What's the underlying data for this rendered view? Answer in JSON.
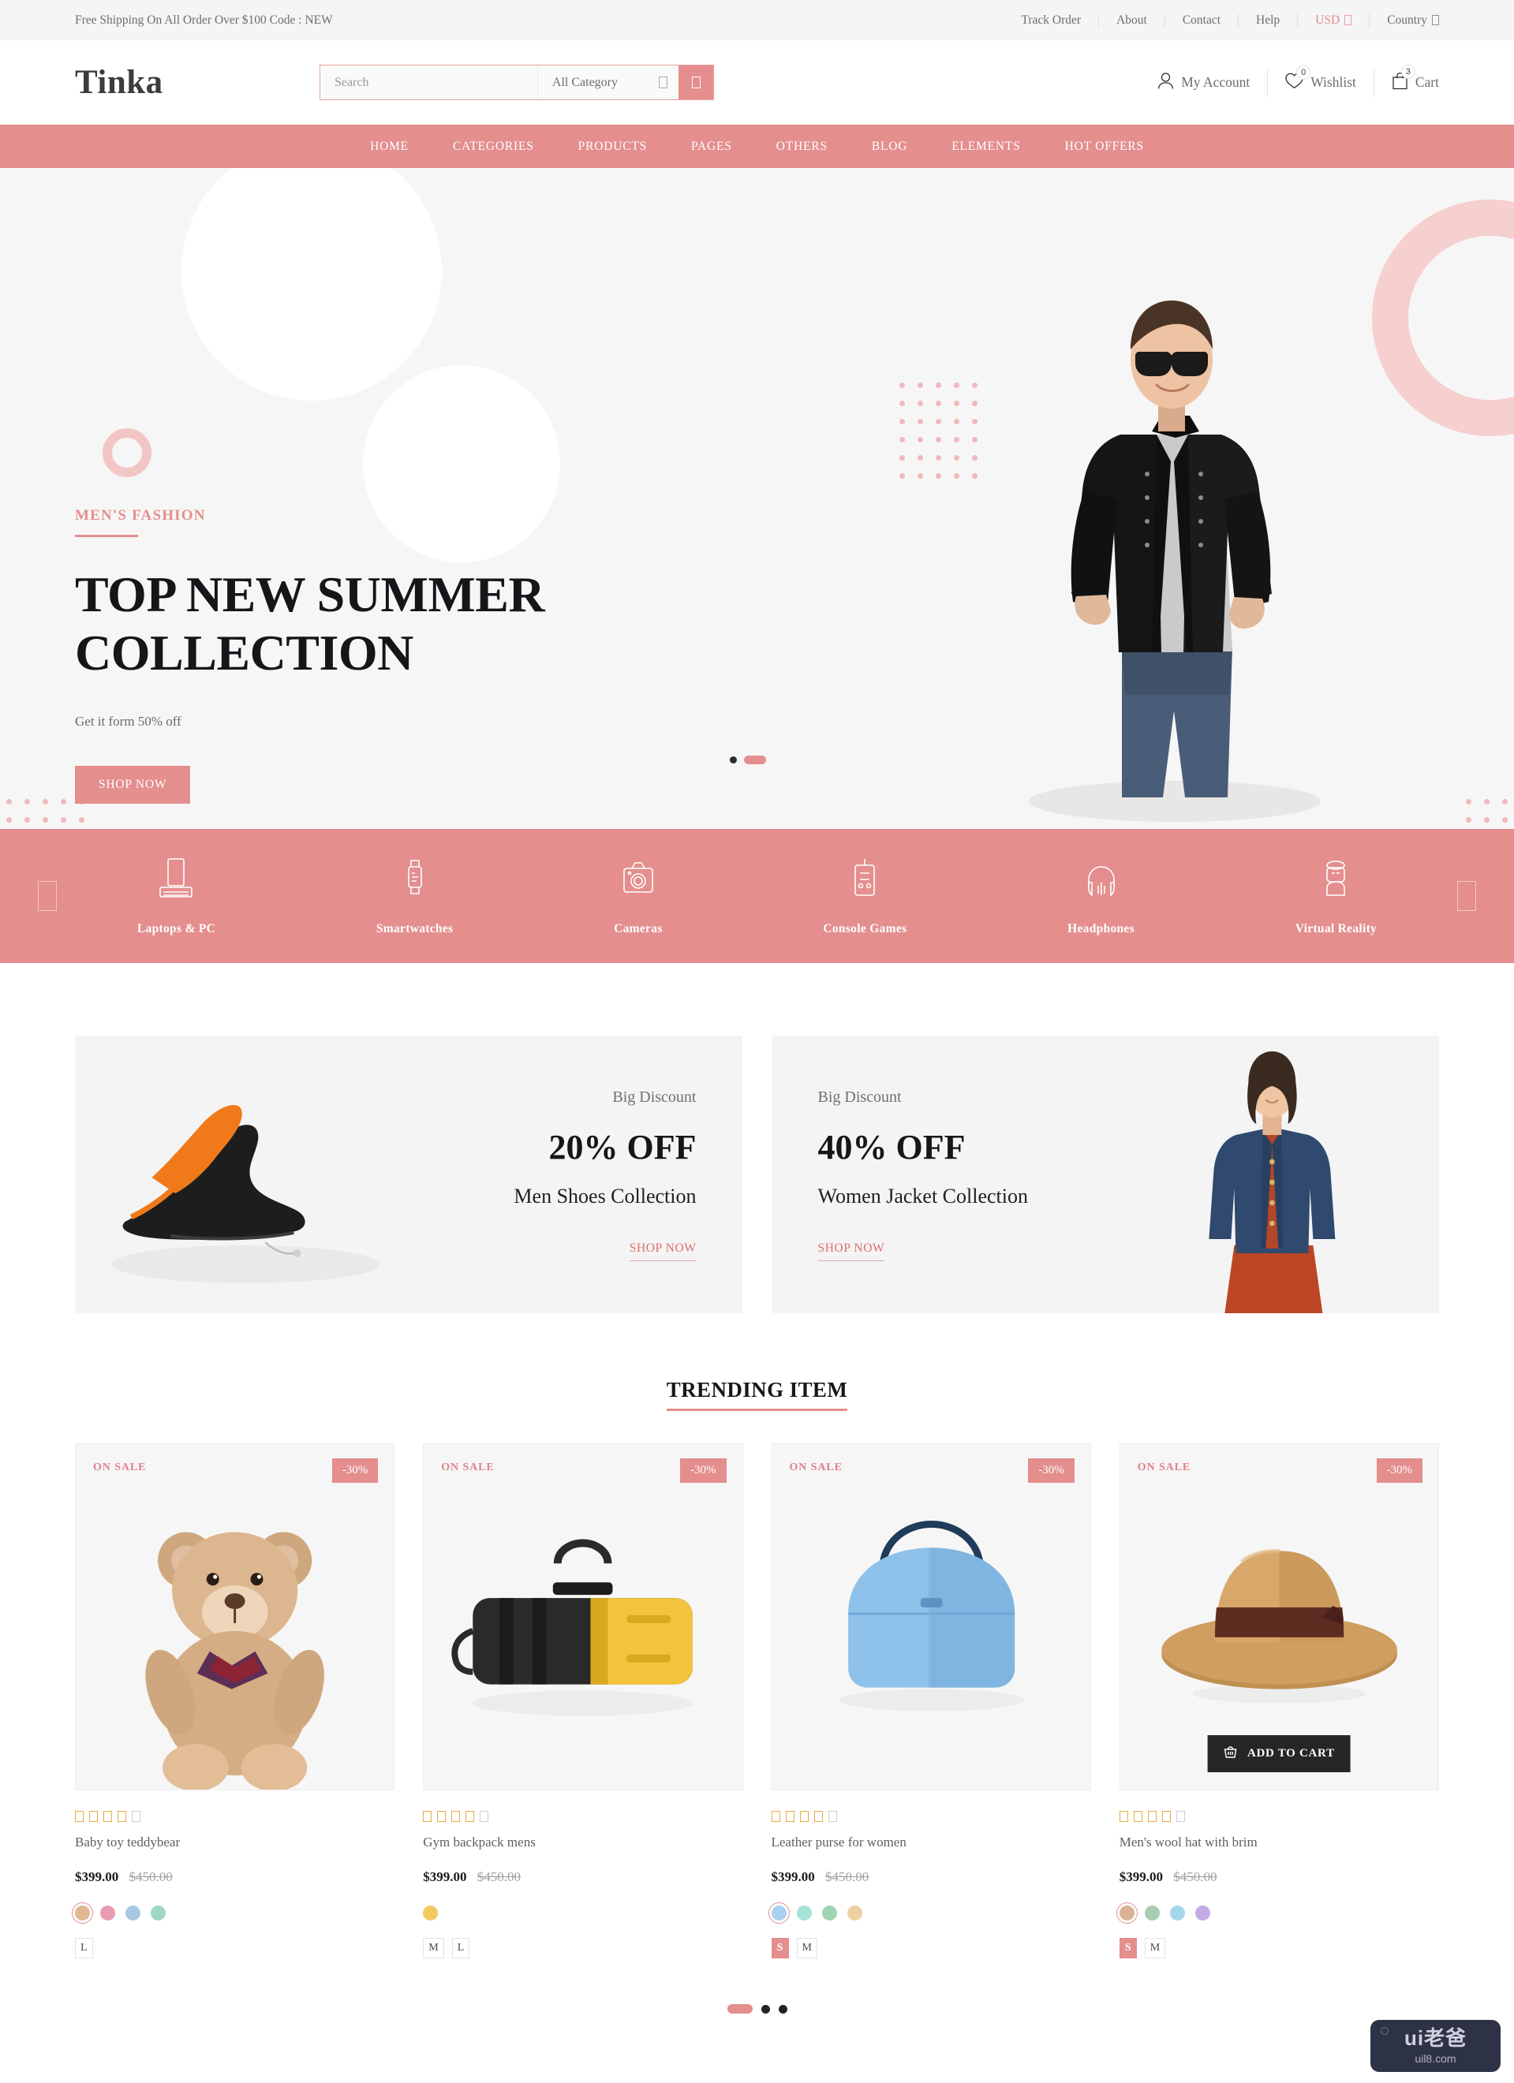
{
  "topbar": {
    "promo": "Free Shipping On All Order Over $100 Code : NEW",
    "links": [
      {
        "label": "Track Order"
      },
      {
        "label": "About"
      },
      {
        "label": "Contact"
      },
      {
        "label": "Help"
      },
      {
        "label": "USD",
        "accent": true,
        "caret": true
      },
      {
        "label": "Country",
        "caret": true
      }
    ]
  },
  "header": {
    "logo": "Tinka",
    "search": {
      "placeholder": "Search",
      "value": "",
      "category": "All Category",
      "search_icon": "search-icon"
    },
    "account": {
      "label": "My Account",
      "icon": "user-icon"
    },
    "wishlist": {
      "label": "Wishlist",
      "icon": "heart-icon",
      "count": "0"
    },
    "cart": {
      "label": "Cart",
      "icon": "bag-icon",
      "count": "3"
    }
  },
  "nav": {
    "items": [
      {
        "label": "HOME"
      },
      {
        "label": "CATEGORIES"
      },
      {
        "label": "PRODUCTS"
      },
      {
        "label": "PAGES"
      },
      {
        "label": "OTHERS"
      },
      {
        "label": "BLOG"
      },
      {
        "label": "ELEMENTS"
      },
      {
        "label": "HOT OFFERS"
      }
    ]
  },
  "hero": {
    "eyebrow": "MEN'S FASHION",
    "title_line1": "TOP NEW SUMMER",
    "title_line2": "COLLECTION",
    "subtitle": "Get it form 50% off",
    "cta": "SHOP NOW",
    "slides": 2,
    "active_slide": 1
  },
  "categories": {
    "prev_icon": "chevron-left-icon",
    "next_icon": "chevron-right-icon",
    "items": [
      {
        "label": "Laptops & PC",
        "icon": "laptop-icon"
      },
      {
        "label": "Smartwatches",
        "icon": "smartwatch-icon"
      },
      {
        "label": "Cameras",
        "icon": "camera-icon"
      },
      {
        "label": "Console Games",
        "icon": "console-icon"
      },
      {
        "label": "Headphones",
        "icon": "headphones-icon"
      },
      {
        "label": "Virtual Reality",
        "icon": "vr-headset-icon"
      }
    ]
  },
  "promos": [
    {
      "small": "Big Discount",
      "big": "20% OFF",
      "name": "Men Shoes Collection",
      "link": "SHOP NOW",
      "image": "black-orange-sneakers"
    },
    {
      "small": "Big Discount",
      "big": "40% OFF",
      "name": "Women Jacket Collection",
      "link": "SHOP NOW",
      "image": "woman-denim-jacket"
    }
  ],
  "trending": {
    "title": "TRENDING ITEM",
    "badge_on_sale": "ON SALE",
    "discount_label": "-30%",
    "add_to_cart": "ADD TO CART",
    "pagination": {
      "total": 3,
      "active": 1
    },
    "products": [
      {
        "name": "Baby toy teddybear",
        "price": "$399.00",
        "old_price": "$450.00",
        "rating": 4,
        "rating_max": 5,
        "image": "teddy-bear",
        "badge": "ON SALE",
        "discount": "-30%",
        "show_add_to_cart": false,
        "colors": [
          "#e0b894",
          "#eb9cb3",
          "#a9c7e2",
          "#9fd8c6"
        ],
        "selected_color": 0,
        "sizes": [
          "L"
        ],
        "selected_size": -1
      },
      {
        "name": "Gym backpack mens",
        "price": "$399.00",
        "old_price": "$450.00",
        "rating": 4,
        "rating_max": 5,
        "image": "yellow-black-duffel-bag",
        "badge": "ON SALE",
        "discount": "-30%",
        "show_add_to_cart": false,
        "colors": [
          "#f3c964"
        ],
        "selected_color": -1,
        "sizes": [
          "M",
          "L"
        ],
        "selected_size": -1
      },
      {
        "name": "Leather purse for women",
        "price": "$399.00",
        "old_price": "$450.00",
        "rating": 4,
        "rating_max": 5,
        "image": "blue-leather-purse",
        "badge": "ON SALE",
        "discount": "-30%",
        "show_add_to_cart": false,
        "colors": [
          "#a9d2f0",
          "#a8e3d8",
          "#9fd3b4",
          "#efd0a2"
        ],
        "selected_color": 0,
        "sizes": [
          "S",
          "M"
        ],
        "selected_size": 0
      },
      {
        "name": "Men's wool hat with brim",
        "price": "$399.00",
        "old_price": "$450.00",
        "rating": 4,
        "rating_max": 5,
        "image": "brown-fedora-hat",
        "badge": "ON SALE",
        "discount": "-30%",
        "show_add_to_cart": true,
        "colors": [
          "#d8b394",
          "#a9cdb0",
          "#a5d7ec",
          "#c3abe6"
        ],
        "selected_color": 0,
        "sizes": [
          "S",
          "M"
        ],
        "selected_size": 0
      }
    ]
  },
  "watermark": {
    "top": "ui老爸",
    "bottom": "uil8.com"
  },
  "colors": {
    "accent": "#e48e8e",
    "accent_text": "#e06d6d",
    "dark": "#14161a",
    "topbar_bg": "#f5f5f5",
    "card_bg": "#f6f6f6",
    "star": "#e8aa3c"
  }
}
